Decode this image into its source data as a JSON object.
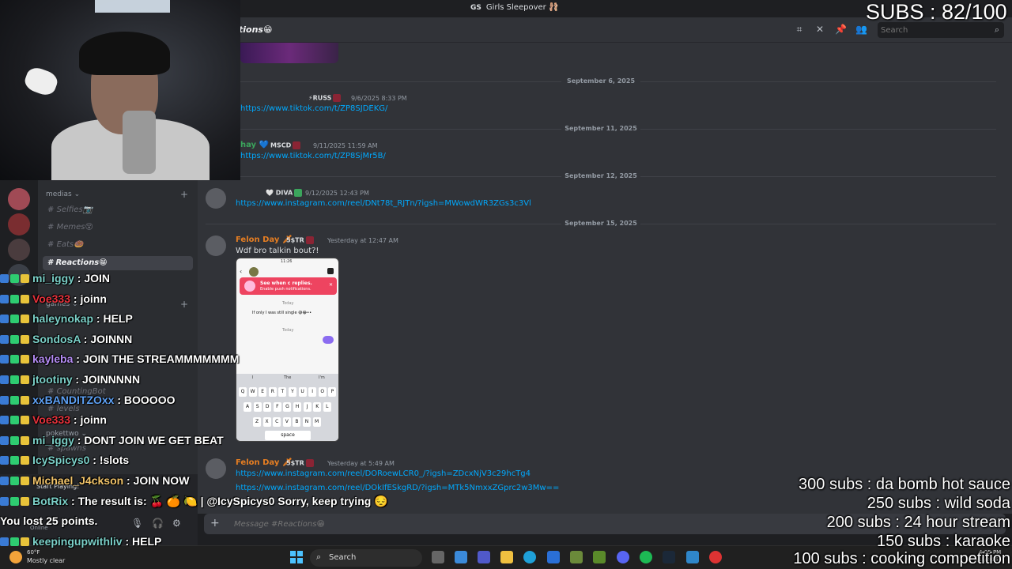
{
  "window": {
    "server_badge": "GS",
    "server_title": "Girls Sleepover 🩰"
  },
  "header": {
    "channel": "#Reactions😁",
    "channel_partial": "tions😁",
    "search_placeholder": "Search"
  },
  "sidebar": {
    "categories": [
      "medias",
      "games",
      "pokettwo"
    ],
    "channels": [
      "Selfies📷",
      "Memes😵",
      "Eats🍩",
      "Reactions😁",
      "CountingBot",
      "levels",
      "spawns"
    ],
    "active_channel": "Reactions😁"
  },
  "messages": [
    {
      "author": "",
      "tag": "⚡RUSS",
      "timestamp": "9/6/2025 8:33 PM",
      "link": "https://www.tiktok.com/t/ZP8SJDEKG/",
      "author_color": "#b845d8"
    },
    {
      "author": "hay 💙",
      "tag": "MSCD",
      "timestamp": "9/11/2025 11:59 AM",
      "link": "https://www.tiktok.com/t/ZP8SjMr5B/",
      "author_color": "#3ba55c"
    },
    {
      "author": "",
      "tag": "🤍 DIVA",
      "timestamp": "9/12/2025 12:43 PM",
      "link": "https://www.instagram.com/reel/DNt78t_RJTn/?igsh=MWowdWR3ZGs3c3Vl",
      "author_color": "#c0392b"
    },
    {
      "author": "Felon Day 🗡",
      "tag": "5$TR",
      "timestamp": "Yesterday at 12:47 AM",
      "text": "Wdf bro talkin bout?!",
      "author_color": "#e67e22"
    },
    {
      "author": "Felon Day 🗡",
      "tag": "5$TR",
      "timestamp": "Yesterday at 5:49 AM",
      "links": [
        "https://www.instagram.com/reel/DORoewLCR0_/?igsh=ZDcxNjV3c29hcTg4",
        "https://www.instagram.com/reel/DOkIfESkgRD/?igsh=MTk5NmxxZGprc2w3Mw=="
      ],
      "author_color": "#e67e22"
    }
  ],
  "date_dividers": [
    "September 6, 2025",
    "September 11, 2025",
    "September 12, 2025",
    "September 15, 2025"
  ],
  "phone_screenshot": {
    "time": "11:26",
    "banner_title": "See when c replies.",
    "banner_sub": "Enable push notifications.",
    "today": "Today",
    "message": "If only I was still single 😅😂••",
    "today2": "Today",
    "suggestions": [
      "I",
      "The",
      "I'm"
    ],
    "row1": [
      "Q",
      "W",
      "E",
      "R",
      "T",
      "Y",
      "U",
      "I",
      "O",
      "P"
    ],
    "row2": [
      "A",
      "S",
      "D",
      "F",
      "G",
      "H",
      "J",
      "K",
      "L"
    ],
    "row3": [
      "Z",
      "X",
      "C",
      "V",
      "B",
      "N",
      "M"
    ],
    "space": "space"
  },
  "composer": {
    "placeholder": "Message #Reactions😁"
  },
  "user_panel": {
    "status": "Online",
    "activity": "Start Playing!"
  },
  "taskbar": {
    "temp": "60°F",
    "weather": "Mostly clear",
    "search": "Search",
    "time": "4:05 PM",
    "date": "9/15/2025"
  },
  "overlay": {
    "subs": "SUBS : 82/100",
    "goals": [
      "300 subs : da bomb hot sauce",
      "250 subs : wild soda",
      "200 subs : 24 hour stream",
      "150 subs : karaoke",
      "100 subs : cooking competition"
    ]
  },
  "chat": [
    {
      "user": "mi_iggy",
      "msg": "JOIN",
      "color": "#7bd0c8"
    },
    {
      "user": "Voe333",
      "msg": "joinn",
      "color": "#e8323c"
    },
    {
      "user": "haleynokap",
      "msg": "HELP",
      "color": "#7bd0c8"
    },
    {
      "user": "SondosA",
      "msg": "JOINNN",
      "color": "#7bd0c8"
    },
    {
      "user": "kayleba",
      "msg": "JOIN THE STREAMMMMMMM",
      "color": "#b58cf5"
    },
    {
      "user": "jtootiny",
      "msg": "JOINNNNN",
      "color": "#7bd0c8"
    },
    {
      "user": "xxBANDITZOxx",
      "msg": "BOOOOO",
      "color": "#5ea1f5"
    },
    {
      "user": "Voe333",
      "msg": "joinn",
      "color": "#e8323c"
    },
    {
      "user": "mi_iggy",
      "msg": "DONT JOIN WE GET BEAT",
      "color": "#7bd0c8"
    },
    {
      "user": "IcySpicys0",
      "msg": "!slots",
      "color": "#7bd0c8"
    },
    {
      "user": "Michael_J4ckson",
      "msg": "JOIN NOW",
      "color": "#f2c46a"
    },
    {
      "user": "BotRix",
      "msg": "The result is: 🍒 🍊 🍋 | @IcySpicys0 Sorry, keep trying 😔",
      "color": "#7bd0c8"
    },
    {
      "user": "",
      "msg": "You lost 25 points.",
      "color": "#ffffff"
    },
    {
      "user": "keepingupwithliv",
      "msg": "HELP",
      "color": "#7bd0c8"
    }
  ]
}
